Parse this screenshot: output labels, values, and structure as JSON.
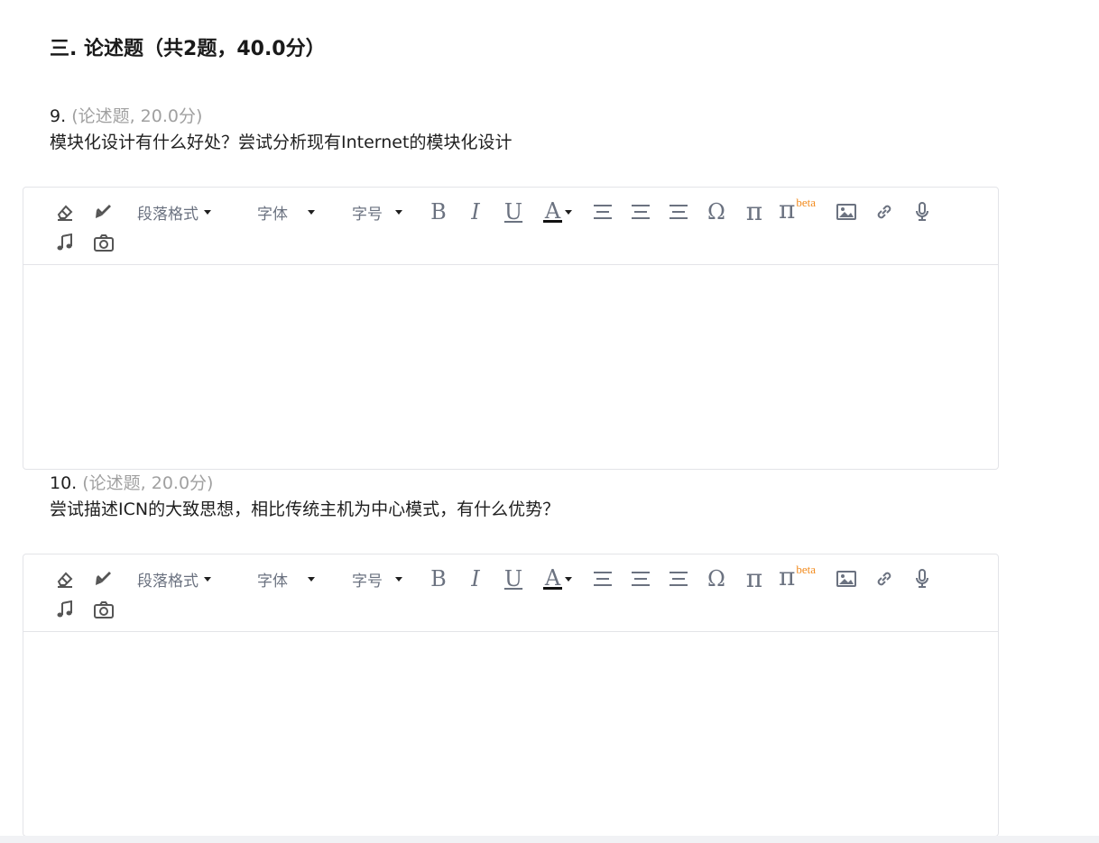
{
  "section": {
    "title": "三. 论述题（共2题，40.0分）"
  },
  "questions": [
    {
      "number": "9.",
      "type": "(论述题, 20.0分)",
      "text": "模块化设计有什么好处？尝试分析现有Internet的模块化设计"
    },
    {
      "number": "10.",
      "type": "(论述题, 20.0分)",
      "text": "尝试描述ICN的大致思想，相比传统主机为中心模式，有什么优势？"
    }
  ],
  "toolbar": {
    "paragraph_label": "段落格式",
    "font_label": "字体",
    "size_label": "字号",
    "bold_glyph": "B",
    "italic_glyph": "I",
    "underline_glyph": "U",
    "color_glyph": "A",
    "omega_glyph": "Ω",
    "pi_glyph": "π",
    "pi_beta_glyph": "π",
    "beta_label": "beta",
    "icons": [
      "eraser-icon",
      "format-brush-icon",
      "align-left-icon",
      "align-center-icon",
      "align-right-icon",
      "image-icon",
      "link-icon",
      "microphone-icon",
      "music-icon",
      "camera-icon"
    ]
  },
  "colors": {
    "beta": "#f28a1c",
    "border": "#e3e4e8",
    "muted": "#a0a0a0"
  }
}
